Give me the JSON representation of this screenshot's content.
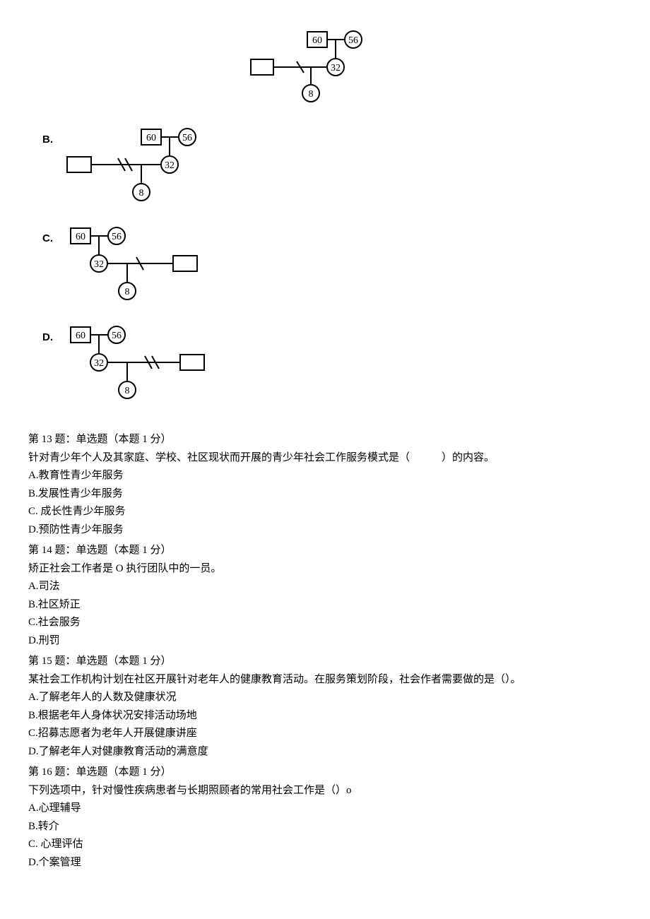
{
  "diagram_labels": {
    "n60": "60",
    "n56": "56",
    "n32": "32",
    "n8": "8"
  },
  "option_prefixes": {
    "B": "B.",
    "C": "C.",
    "D": "D."
  },
  "q13": {
    "header": "第 13 题：单选题（本题 1 分）",
    "body": "针对青少年个人及其家庭、学校、社区现状而开展的青少年社会工作服务模式是（　　　）的内容。",
    "A": "A.教育性青少年服务",
    "B": "B.发展性青少年服务",
    "C": "C. 成长性青少年服务",
    "D": "D.预防性青少年服务"
  },
  "q14": {
    "header": "第 14 题：单选题（本题 1 分）",
    "body": "矫正社会工作者是 O 执行团队中的一员。",
    "A": "A.司法",
    "B": "B.社区矫正",
    "C": "C.社会服务",
    "D": "D.刑罚"
  },
  "q15": {
    "header": "第 15 题：单选题（本题 1 分）",
    "body": "某社会工作机构计划在社区开展针对老年人的健康教育活动。在服务策划阶段，社会作者需要做的是（）。",
    "A": "A.了解老年人的人数及健康状况",
    "B": "B.根据老年人身体状况安排活动场地",
    "C": "C.招募志愿者为老年人开展健康讲座",
    "D": "D.了解老年人对健康教育活动的满意度"
  },
  "q16": {
    "header": "第 16 题：单选题（本题 1 分）",
    "body": "下列选项中，针对慢性疾病患者与长期照顾者的常用社会工作是（）o",
    "A": "A.心理辅导",
    "B": "B.转介",
    "C": "C. 心理评估",
    "D": "D.个案管理"
  }
}
